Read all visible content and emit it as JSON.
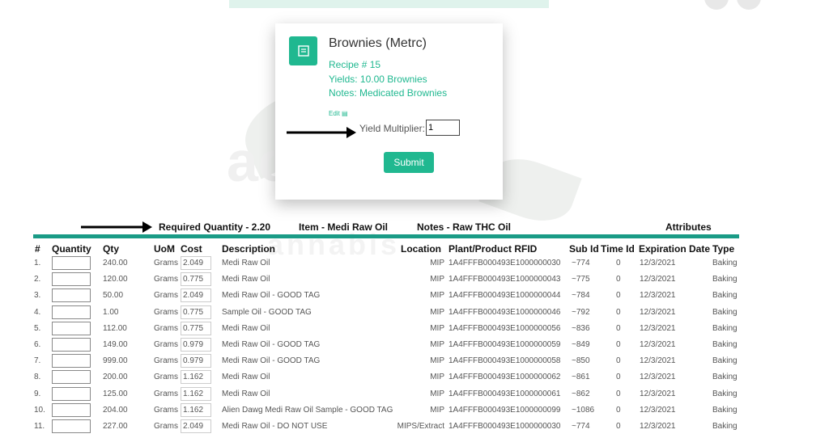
{
  "card": {
    "title": "Brownies (Metrc)",
    "recipe": "Recipe # 15",
    "yields": "Yields: 10.00 Brownies",
    "notes": "Notes: Medicated Brownies",
    "edit": "Edit",
    "yield_label": "Yield Multiplier:",
    "yield_value": "1",
    "submit": "Submit"
  },
  "summary": {
    "required": "Required Quantity - 2.20",
    "item": "Item - Medi Raw Oil",
    "notes": "Notes - Raw THC Oil",
    "attributes": "Attributes"
  },
  "watermark": {
    "line1": "ac",
    "line2": "annabis"
  },
  "table": {
    "headers": [
      "#",
      "Quantity",
      "Qty",
      "UoM",
      "Cost",
      "Description",
      "Location",
      "Plant/Product RFID",
      "Sub Id",
      "Time Id",
      "Expiration Date",
      "Type"
    ],
    "rows": [
      {
        "n": "1.",
        "qty": "240.00",
        "uom": "Grams",
        "cost": "2.049",
        "desc": "Medi Raw Oil",
        "loc": "MIP",
        "rfid": "1A4FFFB000493E1000000030",
        "sub": "~774",
        "time": "0",
        "exp": "12/3/2021",
        "type": "Baking"
      },
      {
        "n": "2.",
        "qty": "120.00",
        "uom": "Grams",
        "cost": "0.775",
        "desc": "Medi Raw Oil",
        "loc": "MIP",
        "rfid": "1A4FFFB000493E1000000043",
        "sub": "~775",
        "time": "0",
        "exp": "12/3/2021",
        "type": "Baking"
      },
      {
        "n": "3.",
        "qty": "50.00",
        "uom": "Grams",
        "cost": "2.049",
        "desc": "Medi Raw Oil - GOOD TAG",
        "loc": "MIP",
        "rfid": "1A4FFFB000493E1000000044",
        "sub": "~784",
        "time": "0",
        "exp": "12/3/2021",
        "type": "Baking"
      },
      {
        "n": "4.",
        "qty": "1.00",
        "uom": "Grams",
        "cost": "0.775",
        "desc": "Sample Oil - GOOD TAG",
        "loc": "MIP",
        "rfid": "1A4FFFB000493E1000000046",
        "sub": "~792",
        "time": "0",
        "exp": "12/3/2021",
        "type": "Baking"
      },
      {
        "n": "5.",
        "qty": "112.00",
        "uom": "Grams",
        "cost": "0.775",
        "desc": "Medi Raw Oil",
        "loc": "MIP",
        "rfid": "1A4FFFB000493E1000000056",
        "sub": "~836",
        "time": "0",
        "exp": "12/3/2021",
        "type": "Baking"
      },
      {
        "n": "6.",
        "qty": "149.00",
        "uom": "Grams",
        "cost": "0.979",
        "desc": "Medi Raw Oil - GOOD TAG",
        "loc": "MIP",
        "rfid": "1A4FFFB000493E1000000059",
        "sub": "~849",
        "time": "0",
        "exp": "12/3/2021",
        "type": "Baking"
      },
      {
        "n": "7.",
        "qty": "999.00",
        "uom": "Grams",
        "cost": "0.979",
        "desc": "Medi Raw Oil - GOOD TAG",
        "loc": "MIP",
        "rfid": "1A4FFFB000493E1000000058",
        "sub": "~850",
        "time": "0",
        "exp": "12/3/2021",
        "type": "Baking"
      },
      {
        "n": "8.",
        "qty": "200.00",
        "uom": "Grams",
        "cost": "1.162",
        "desc": "Medi Raw Oil",
        "loc": "MIP",
        "rfid": "1A4FFFB000493E1000000062",
        "sub": "~861",
        "time": "0",
        "exp": "12/3/2021",
        "type": "Baking"
      },
      {
        "n": "9.",
        "qty": "125.00",
        "uom": "Grams",
        "cost": "1.162",
        "desc": "Medi Raw Oil",
        "loc": "MIP",
        "rfid": "1A4FFFB000493E1000000061",
        "sub": "~862",
        "time": "0",
        "exp": "12/3/2021",
        "type": "Baking"
      },
      {
        "n": "10.",
        "qty": "204.00",
        "uom": "Grams",
        "cost": "1.162",
        "desc": "Alien Dawg Medi Raw Oil Sample - GOOD TAG",
        "loc": "MIP",
        "rfid": "1A4FFFB000493E1000000099",
        "sub": "~1086",
        "time": "0",
        "exp": "12/3/2021",
        "type": "Baking"
      },
      {
        "n": "11.",
        "qty": "227.00",
        "uom": "Grams",
        "cost": "2.049",
        "desc": "Medi Raw Oil - DO NOT USE",
        "loc": "MIPS/Extract",
        "rfid": "1A4FFFB000493E1000000030",
        "sub": "~774",
        "time": "0",
        "exp": "12/3/2021",
        "type": "Baking"
      }
    ]
  }
}
